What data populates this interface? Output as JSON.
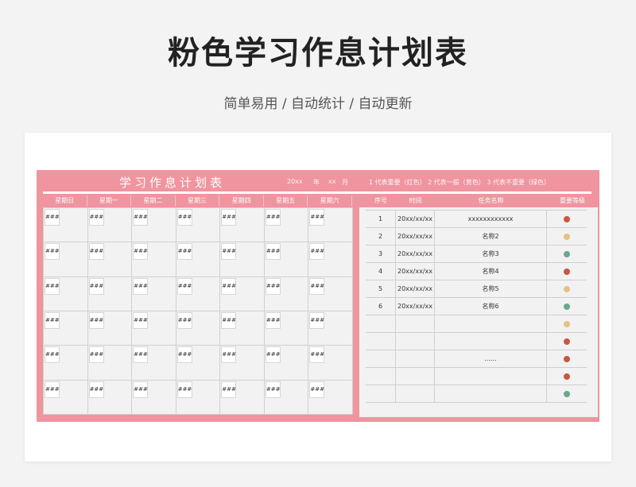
{
  "header": {
    "title": "粉色学习作息计划表",
    "subtitle": "简单易用 / 自动统计 / 自动更新"
  },
  "sheet": {
    "title": "学习作息计划表",
    "year": "20xx",
    "year_label": "年",
    "month": "xx",
    "month_label": "月",
    "legend": "1 代表重要（红色）  2 代表一般（黄色）  3 代表不重要（绿色）"
  },
  "week": {
    "days": [
      "星期日",
      "星期一",
      "星期二",
      "星期三",
      "星期四",
      "星期五",
      "星期六"
    ],
    "cell_text": "###",
    "rows": 6
  },
  "tasks": {
    "columns": [
      "序号",
      "时间",
      "任务名称",
      "重要等级"
    ],
    "rows": [
      {
        "no": "1",
        "time": "20xx/xx/xx",
        "name": "xxxxxxxxxxxx",
        "level": "red"
      },
      {
        "no": "2",
        "time": "20xx/xx/xx",
        "name": "名称2",
        "level": "yellow"
      },
      {
        "no": "3",
        "time": "20xx/xx/xx",
        "name": "名称3",
        "level": "green"
      },
      {
        "no": "4",
        "time": "20xx/xx/xx",
        "name": "名称4",
        "level": "red"
      },
      {
        "no": "5",
        "time": "20xx/xx/xx",
        "name": "名称5",
        "level": "yellow"
      },
      {
        "no": "6",
        "time": "20xx/xx/xx",
        "name": "名称6",
        "level": "green"
      },
      {
        "no": "",
        "time": "",
        "name": "",
        "level": "yellow"
      },
      {
        "no": "",
        "time": "",
        "name": "",
        "level": "red"
      },
      {
        "no": "",
        "time": "",
        "name": "......",
        "level": "red"
      },
      {
        "no": "",
        "time": "",
        "name": "",
        "level": "red"
      },
      {
        "no": "",
        "time": "",
        "name": "",
        "level": "green"
      }
    ]
  },
  "colors": {
    "accent": "#f0949f",
    "red": "#c9573f",
    "yellow": "#e5c27e",
    "green": "#6aa88a"
  }
}
